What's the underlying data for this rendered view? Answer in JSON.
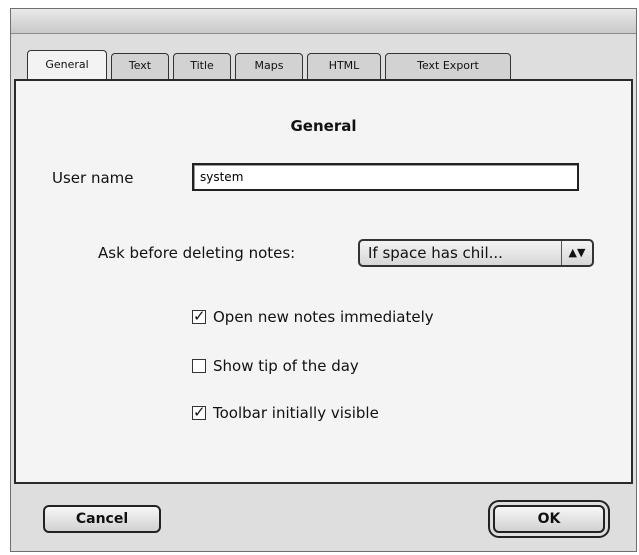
{
  "tabs": [
    {
      "label": "General",
      "active": true
    },
    {
      "label": "Text",
      "active": false
    },
    {
      "label": "Title",
      "active": false
    },
    {
      "label": "Maps",
      "active": false
    },
    {
      "label": "HTML",
      "active": false
    },
    {
      "label": "Text Export",
      "active": false
    }
  ],
  "panel": {
    "title": "General",
    "user_name_label": "User name",
    "user_name_value": "system",
    "ask_delete_label": "Ask before deleting notes:",
    "ask_delete_selected": "If space has chil...",
    "options": [
      {
        "label": "Open new notes immediately",
        "checked": true
      },
      {
        "label": "Show tip of the day",
        "checked": false
      },
      {
        "label": "Toolbar initially visible",
        "checked": true
      }
    ]
  },
  "buttons": {
    "cancel": "Cancel",
    "ok": "OK"
  }
}
